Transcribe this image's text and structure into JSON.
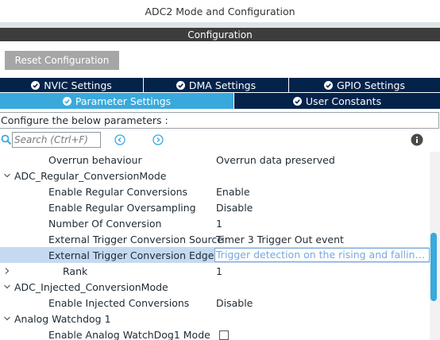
{
  "window": {
    "title": "ADC2 Mode and Configuration"
  },
  "section": {
    "header": "Configuration"
  },
  "toolbar": {
    "reset_label": "Reset Configuration"
  },
  "tabs_row1": [
    {
      "label": "NVIC Settings"
    },
    {
      "label": "DMA Settings"
    },
    {
      "label": "GPIO Settings"
    }
  ],
  "tabs_row2": [
    {
      "label": "Parameter Settings",
      "active": true
    },
    {
      "label": "User Constants"
    }
  ],
  "configure_text": "Configure the below parameters :",
  "search": {
    "placeholder": "Search (Ctrl+F)"
  },
  "tree": [
    {
      "name": "Overrun behaviour",
      "value": "Overrun data preserved"
    },
    {
      "name": "ADC_Regular_ConversionMode",
      "value": ""
    },
    {
      "name": "Enable Regular Conversions",
      "value": "Enable"
    },
    {
      "name": "Enable Regular Oversampling",
      "value": "Disable"
    },
    {
      "name": "Number Of Conversion",
      "value": "1"
    },
    {
      "name": "External Trigger Conversion Source",
      "value": "Timer 3 Trigger Out event"
    },
    {
      "name": "External Trigger Conversion Edge",
      "value": "Trigger detection on the rising and falling ed..."
    },
    {
      "name": "Rank",
      "value": "1"
    },
    {
      "name": "ADC_Injected_ConversionMode",
      "value": ""
    },
    {
      "name": "Enable Injected Conversions",
      "value": "Disable"
    },
    {
      "name": "Analog Watchdog 1",
      "value": ""
    },
    {
      "name": "Enable Analog WatchDog1 Mode",
      "value": ""
    }
  ],
  "colors": {
    "tab_dark": "#03234b",
    "tab_active": "#39a9dc",
    "header_bg": "#3d3d3d",
    "selected_row": "#c5daf2",
    "button_gray": "#a6a6a6"
  }
}
